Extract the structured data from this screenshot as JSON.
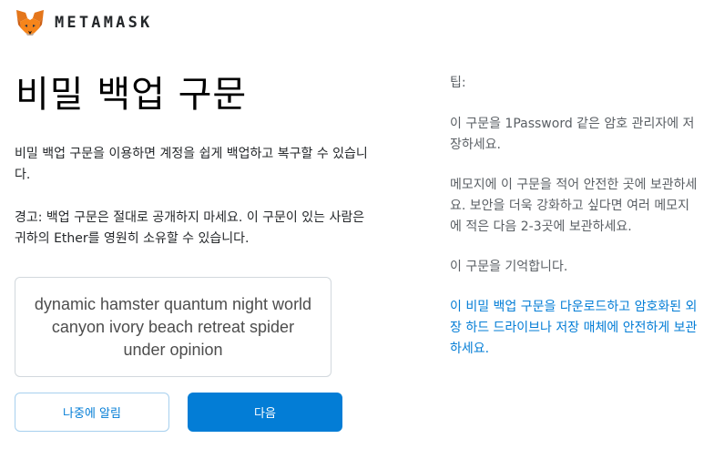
{
  "header": {
    "brand": "METAMASK"
  },
  "main": {
    "title": "비밀 백업 구문",
    "description": "비밀 백업 구문을 이용하면 계정을 쉽게 백업하고 복구할 수 있습니다.",
    "warning": "경고: 백업 구문은 절대로 공개하지 마세요. 이 구문이 있는 사람은 귀하의 Ether를 영원히 소유할 수 있습니다.",
    "seed_phrase": "dynamic hamster quantum night world canyon ivory beach retreat spider under opinion"
  },
  "buttons": {
    "remind_later": "나중에 알림",
    "next": "다음"
  },
  "tips": {
    "title": "팁:",
    "items": [
      "이 구문을 1Password 같은 암호 관리자에 저장하세요.",
      "메모지에 이 구문을 적어 안전한 곳에 보관하세요. 보안을 더욱 강화하고 싶다면 여러 메모지에 적은 다음 2-3곳에 보관하세요.",
      "이 구문을 기억합니다."
    ],
    "download_link": "이 비밀 백업 구문을 다운로드하고 암호화된 외장 하드 드라이브나 저장 매체에 안전하게 보관하세요."
  },
  "colors": {
    "accent": "#037dd6",
    "fox_orange": "#e2761b"
  }
}
